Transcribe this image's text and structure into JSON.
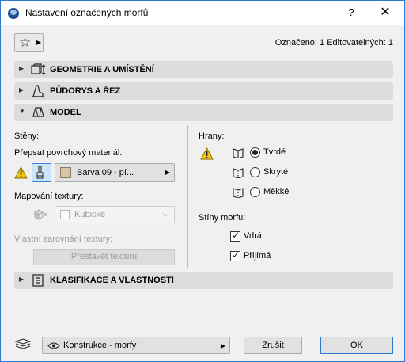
{
  "window": {
    "title": "Nastavení označených morfů",
    "help_label": "?",
    "close_label": "✕"
  },
  "header": {
    "favorites_icon": "star-icon",
    "selection_info": "Označeno: 1 Editovatelných: 1"
  },
  "sections": [
    {
      "label": "GEOMETRIE A UMÍSTĚNÍ",
      "icon": "geometry-icon",
      "expanded": false
    },
    {
      "label": "PŮDORYS A ŘEZ",
      "icon": "floorplan-icon",
      "expanded": false
    },
    {
      "label": "MODEL",
      "icon": "model-icon",
      "expanded": true
    },
    {
      "label": "KLASIFIKACE A VLASTNOSTI",
      "icon": "classification-icon",
      "expanded": false
    }
  ],
  "model": {
    "faces_label": "Stěny:",
    "override_material_label": "Přepsat povrchový materiál:",
    "material_value": "Barva 09 - pí...",
    "texture_mapping_label": "Mapování textury:",
    "texture_mapping_value": "Kubické",
    "custom_alignment_label": "Vlastní zarovnání textury:",
    "rebuild_texture_label": "Přestavět texturu",
    "edges_label": "Hrany:",
    "edges_options": [
      {
        "label": "Tvrdé",
        "selected": true
      },
      {
        "label": "Skryté",
        "selected": false
      },
      {
        "label": "Měkké",
        "selected": false
      }
    ],
    "shadows_label": "Stíny morfu:",
    "shadows_options": [
      {
        "label": "Vrhá",
        "checked": true
      },
      {
        "label": "Přijímá",
        "checked": true
      }
    ]
  },
  "footer": {
    "layer_value": "Konstrukce - morfy",
    "cancel_label": "Zrušit",
    "ok_label": "OK"
  },
  "colors": {
    "accent": "#2b79d0",
    "section_bg": "#dcdcdc",
    "dialog_bg": "#f0f0f0",
    "material_swatch": "#d6c6a6",
    "warning": "#f2c811"
  }
}
